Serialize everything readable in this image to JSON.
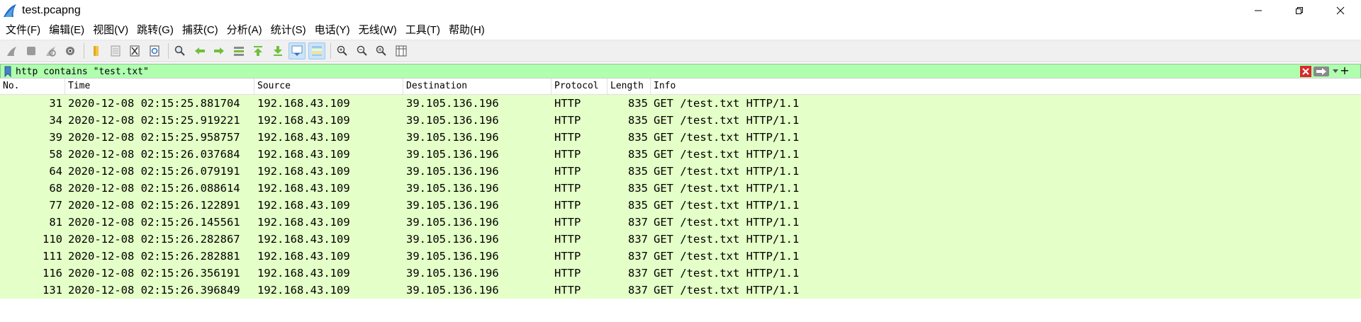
{
  "window": {
    "title": "test.pcapng"
  },
  "menu": [
    {
      "label": "文件(F)"
    },
    {
      "label": "编辑(E)"
    },
    {
      "label": "视图(V)"
    },
    {
      "label": "跳转(G)"
    },
    {
      "label": "捕获(C)"
    },
    {
      "label": "分析(A)"
    },
    {
      "label": "统计(S)"
    },
    {
      "label": "电话(Y)"
    },
    {
      "label": "无线(W)"
    },
    {
      "label": "工具(T)"
    },
    {
      "label": "帮助(H)"
    }
  ],
  "toolbar": {
    "buttons": [
      "start-capture-icon",
      "stop-capture-icon",
      "restart-capture-icon",
      "capture-options-icon",
      "open-file-icon",
      "save-file-icon",
      "close-file-icon",
      "reload-file-icon",
      "find-packet-icon",
      "go-back-icon",
      "go-forward-icon",
      "go-to-packet-icon",
      "first-packet-icon",
      "last-packet-icon",
      "autoscroll-icon",
      "colorize-icon",
      "zoom-in-icon",
      "zoom-out-icon",
      "normal-size-icon",
      "resize-columns-icon"
    ],
    "active": [
      "autoscroll-icon",
      "colorize-icon"
    ]
  },
  "filter": {
    "value": "http contains \"test.txt\"",
    "background": "#afffaf"
  },
  "columns": {
    "no": "No.",
    "time": "Time",
    "source": "Source",
    "destination": "Destination",
    "protocol": "Protocol",
    "length": "Length",
    "info": "Info"
  },
  "row_color": "#e4ffc7",
  "packets": [
    {
      "no": "31",
      "time": "2020-12-08 02:15:25.881704",
      "source": "192.168.43.109",
      "destination": "39.105.136.196",
      "protocol": "HTTP",
      "length": "835",
      "info": "GET /test.txt HTTP/1.1"
    },
    {
      "no": "34",
      "time": "2020-12-08 02:15:25.919221",
      "source": "192.168.43.109",
      "destination": "39.105.136.196",
      "protocol": "HTTP",
      "length": "835",
      "info": "GET /test.txt HTTP/1.1"
    },
    {
      "no": "39",
      "time": "2020-12-08 02:15:25.958757",
      "source": "192.168.43.109",
      "destination": "39.105.136.196",
      "protocol": "HTTP",
      "length": "835",
      "info": "GET /test.txt HTTP/1.1"
    },
    {
      "no": "58",
      "time": "2020-12-08 02:15:26.037684",
      "source": "192.168.43.109",
      "destination": "39.105.136.196",
      "protocol": "HTTP",
      "length": "835",
      "info": "GET /test.txt HTTP/1.1"
    },
    {
      "no": "64",
      "time": "2020-12-08 02:15:26.079191",
      "source": "192.168.43.109",
      "destination": "39.105.136.196",
      "protocol": "HTTP",
      "length": "835",
      "info": "GET /test.txt HTTP/1.1"
    },
    {
      "no": "68",
      "time": "2020-12-08 02:15:26.088614",
      "source": "192.168.43.109",
      "destination": "39.105.136.196",
      "protocol": "HTTP",
      "length": "835",
      "info": "GET /test.txt HTTP/1.1"
    },
    {
      "no": "77",
      "time": "2020-12-08 02:15:26.122891",
      "source": "192.168.43.109",
      "destination": "39.105.136.196",
      "protocol": "HTTP",
      "length": "835",
      "info": "GET /test.txt HTTP/1.1"
    },
    {
      "no": "81",
      "time": "2020-12-08 02:15:26.145561",
      "source": "192.168.43.109",
      "destination": "39.105.136.196",
      "protocol": "HTTP",
      "length": "837",
      "info": "GET /test.txt HTTP/1.1"
    },
    {
      "no": "110",
      "time": "2020-12-08 02:15:26.282867",
      "source": "192.168.43.109",
      "destination": "39.105.136.196",
      "protocol": "HTTP",
      "length": "837",
      "info": "GET /test.txt HTTP/1.1"
    },
    {
      "no": "111",
      "time": "2020-12-08 02:15:26.282881",
      "source": "192.168.43.109",
      "destination": "39.105.136.196",
      "protocol": "HTTP",
      "length": "837",
      "info": "GET /test.txt HTTP/1.1"
    },
    {
      "no": "116",
      "time": "2020-12-08 02:15:26.356191",
      "source": "192.168.43.109",
      "destination": "39.105.136.196",
      "protocol": "HTTP",
      "length": "837",
      "info": "GET /test.txt HTTP/1.1"
    },
    {
      "no": "131",
      "time": "2020-12-08 02:15:26.396849",
      "source": "192.168.43.109",
      "destination": "39.105.136.196",
      "protocol": "HTTP",
      "length": "837",
      "info": "GET /test.txt HTTP/1.1"
    }
  ]
}
